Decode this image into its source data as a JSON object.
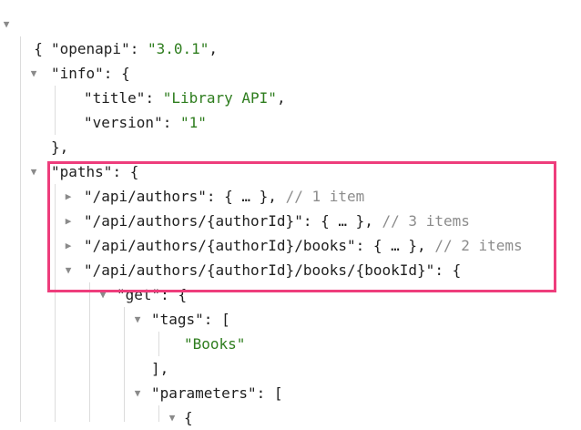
{
  "root": {
    "open": "{"
  },
  "openapi": {
    "key": "\"openapi\"",
    "sep": ": ",
    "value": "\"3.0.1\"",
    "comma": ","
  },
  "info": {
    "key": "\"info\"",
    "sep": ": ",
    "open": "{",
    "title": {
      "key": "\"title\"",
      "sep": ": ",
      "value": "\"Library API\"",
      "comma": ","
    },
    "version": {
      "key": "\"version\"",
      "sep": ": ",
      "value": "\"1\""
    },
    "close": "},"
  },
  "paths": {
    "key": "\"paths\"",
    "sep": ": ",
    "open": "{",
    "items": [
      {
        "key": "\"/api/authors\"",
        "sep": ": ",
        "collapsed": "{ … },",
        "comment": "// 1 item"
      },
      {
        "key": "\"/api/authors/{authorId}\"",
        "sep": ": ",
        "collapsed": "{ … },",
        "comment": "// 3 items"
      },
      {
        "key": "\"/api/authors/{authorId}/books\"",
        "sep": ": ",
        "collapsed": "{ … },",
        "comment": "// 2 items"
      },
      {
        "key": "\"/api/authors/{authorId}/books/{bookId}\"",
        "sep": ": ",
        "open": "{"
      }
    ]
  },
  "get": {
    "key": "\"get\"",
    "sep": ": ",
    "open": "{"
  },
  "tags": {
    "key": "\"tags\"",
    "sep": ": ",
    "open": "[",
    "value": "\"Books\"",
    "close": "],"
  },
  "parameters": {
    "key": "\"parameters\"",
    "sep": ": ",
    "open": "[",
    "next_open": "{"
  },
  "icons": {
    "expanded": "caret-down-icon",
    "collapsed": "caret-right-icon",
    "expanded_glyph": "▼",
    "collapsed_glyph": "▶"
  },
  "colors": {
    "string": "#2e7d1e",
    "comment": "#8c8c8c",
    "highlight": "#ee3d7c",
    "guide": "#dcdcdc"
  }
}
